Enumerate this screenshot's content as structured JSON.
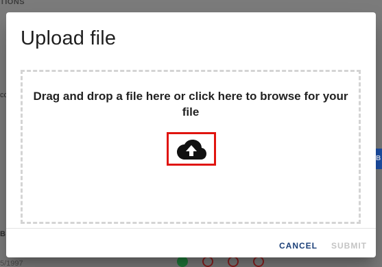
{
  "background": {
    "top_label": "TIONS",
    "left_fragment_1": "cc",
    "left_fragment_2": "B",
    "date_fragment": "5/1997",
    "blue_button_fragment": "B"
  },
  "dialog": {
    "title": "Upload file",
    "dropzone_text": "Drag and drop a file here or click here to browse for your file",
    "upload_icon": "cloud-upload-icon",
    "cancel_label": "CANCEL",
    "submit_label": "SUBMIT"
  },
  "colors": {
    "scrim": "#7b7b7b",
    "highlight_border": "#e0140e",
    "cancel_text": "#1b3f78",
    "disabled_text": "#c4c4c4"
  }
}
